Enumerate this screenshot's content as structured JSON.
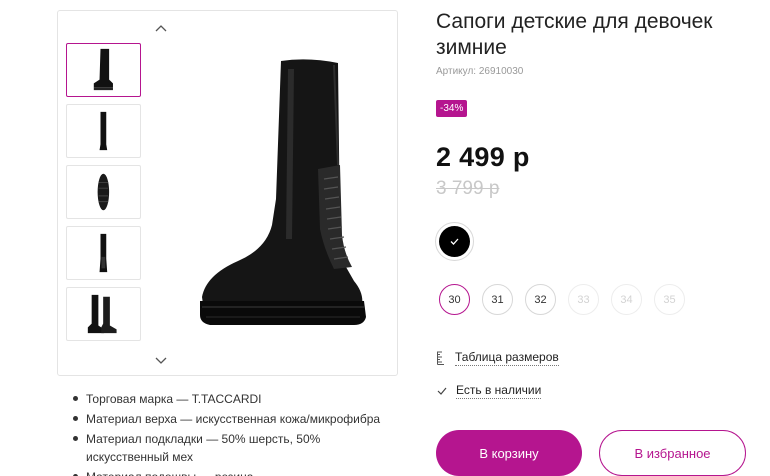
{
  "product": {
    "title": "Сапоги детские для девочек зимние",
    "sku": "Артикул: 26910030",
    "discount": "-34%",
    "price": "2 499 р",
    "old_price": "3 799 р"
  },
  "colors": {
    "selected": "#000000",
    "accent": "#b5158f"
  },
  "sizes": [
    {
      "label": "30",
      "state": "selected"
    },
    {
      "label": "31",
      "state": "available"
    },
    {
      "label": "32",
      "state": "available"
    },
    {
      "label": "33",
      "state": "disabled"
    },
    {
      "label": "34",
      "state": "disabled"
    },
    {
      "label": "35",
      "state": "disabled"
    }
  ],
  "links": {
    "size_table": "Таблица размеров",
    "in_stock": "Есть в наличии"
  },
  "buttons": {
    "cart": "В корзину",
    "favorites": "В избранное"
  },
  "specs": [
    "Торговая марка — T.TACCARDI",
    "Материал верха — искусственная кожа/микрофибра",
    "Материал подкладки — 50% шерсть, 50% искусственный мех",
    "Материал подошвы — резина"
  ],
  "gallery": {
    "icons": [
      "chevron-up-icon",
      "chevron-down-icon"
    ],
    "thumbnail_views": [
      "side",
      "front",
      "sole",
      "back",
      "pair"
    ]
  }
}
